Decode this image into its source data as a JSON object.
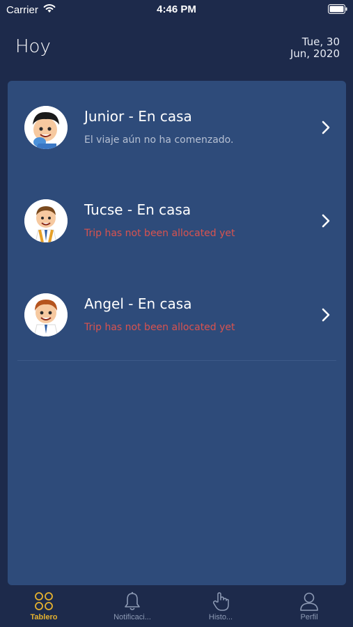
{
  "status_bar": {
    "carrier": "Carrier",
    "time": "4:46 PM"
  },
  "header": {
    "title": "Hoy",
    "date_line1": "Tue, 30",
    "date_line2": "Jun, 2020"
  },
  "students": [
    {
      "name": "Junior - En casa",
      "status": "El viaje aún no ha comenzado.",
      "status_type": "neutral",
      "avatar_icon": "boy-avatar-icon"
    },
    {
      "name": "Tucse - En casa",
      "status": "Trip has not been allocated yet",
      "status_type": "alert",
      "avatar_icon": "boy-avatar-icon"
    },
    {
      "name": "Angel - En casa",
      "status": "Trip has not been allocated yet",
      "status_type": "alert",
      "avatar_icon": "boy-avatar-icon"
    }
  ],
  "tabs": [
    {
      "label": "Tablero",
      "icon": "dashboard-icon",
      "active": true
    },
    {
      "label": "Notificaci...",
      "icon": "bell-icon",
      "active": false
    },
    {
      "label": "Histo...",
      "icon": "hand-pointer-icon",
      "active": false
    },
    {
      "label": "Perfil",
      "icon": "user-icon",
      "active": false
    }
  ],
  "colors": {
    "background": "#1d2a4b",
    "card": "#2e4b7a",
    "accent": "#e6b22e",
    "alert": "#d9534f"
  }
}
